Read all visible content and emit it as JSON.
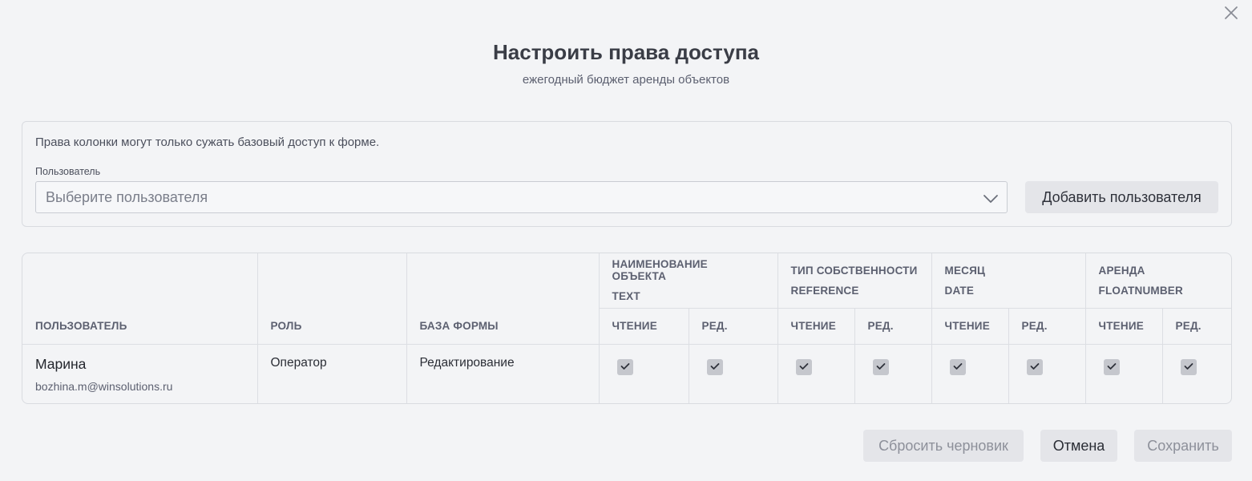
{
  "dialog": {
    "title": "Настроить права доступа",
    "subtitle": "ежегодный бюджет аренды объектов",
    "close_icon": "close-icon"
  },
  "panel": {
    "note": "Права колонки могут только сужать базовый доступ к форме.",
    "user_label": "Пользователь",
    "user_placeholder": "Выберите пользователя",
    "add_user_label": "Добавить пользователя"
  },
  "table": {
    "headers": {
      "user": "ПОЛЬЗОВАТЕЛЬ",
      "role": "РОЛЬ",
      "form_base": "БАЗА ФОРМЫ"
    },
    "columns": [
      {
        "name": "НАИМЕНОВАНИЕ ОБЪЕКТА",
        "type": "TEXT"
      },
      {
        "name": "ТИП СОБСТВЕННОСТИ",
        "type": "REFERENCE"
      },
      {
        "name": "МЕСЯЦ",
        "type": "DATE"
      },
      {
        "name": "АРЕНДА",
        "type": "FLOATNUMBER"
      }
    ],
    "read_label": "ЧТЕНИЕ",
    "edit_label": "РЕД.",
    "rows": [
      {
        "name": "Марина",
        "email": "bozhina.m@winsolutions.ru",
        "role": "Оператор",
        "form_base": "Редактирование",
        "perms": [
          true,
          true,
          true,
          true,
          true,
          true,
          true,
          true
        ]
      }
    ]
  },
  "footer": {
    "reset_label": "Сбросить черновик",
    "cancel_label": "Отмена",
    "save_label": "Сохранить"
  }
}
